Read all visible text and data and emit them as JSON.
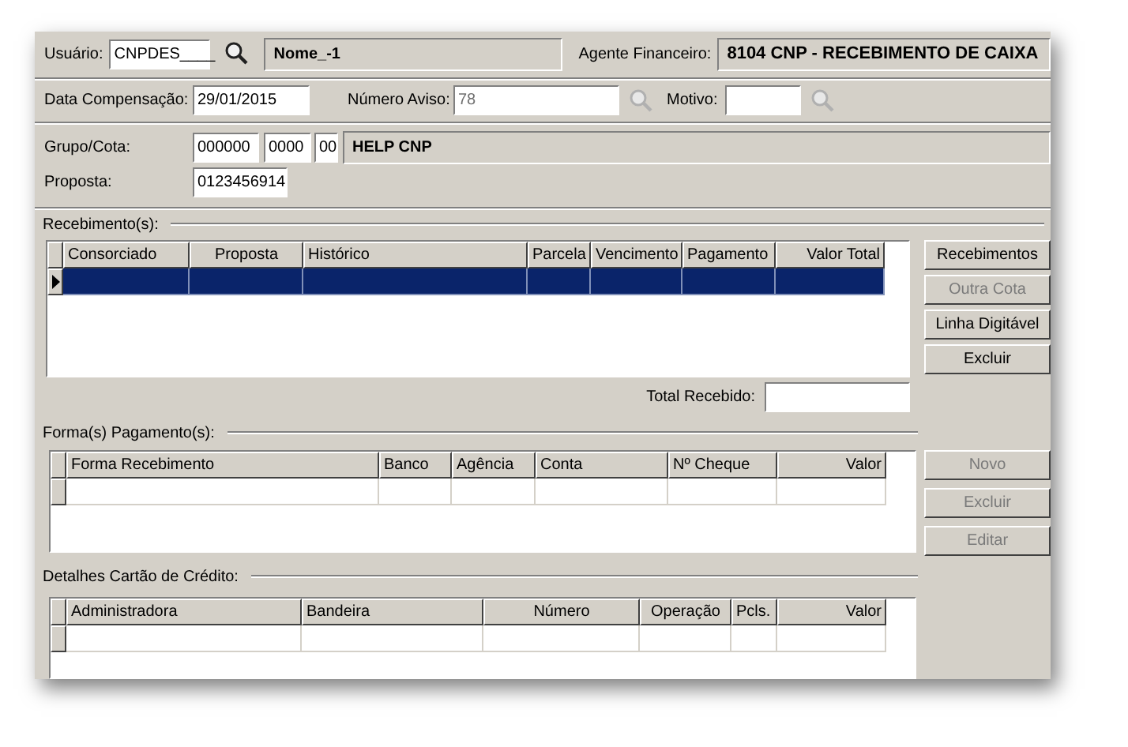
{
  "header": {
    "user": {
      "label": "Usuário:",
      "value": "CNPDES____",
      "lookup_disabled": false
    },
    "name": "Nome_-1",
    "agent": {
      "label": "Agente Financeiro:",
      "value": "8104  CNP - RECEBIMENTO DE CAIXA"
    }
  },
  "filters": {
    "date": {
      "label": "Data Compensação:",
      "value": "29/01/2015"
    },
    "notice": {
      "label": "Número Aviso:",
      "value": "78",
      "disabled": true,
      "lookup_disabled": true
    },
    "reason": {
      "label": "Motivo:",
      "lookup_disabled": true
    }
  },
  "group_quota": {
    "label": "Grupo/Cota:",
    "group": "000000",
    "quota": "0000",
    "digit": "00",
    "description": "HELP CNP"
  },
  "proposal": {
    "label": "Proposta:",
    "value": "0123456914"
  },
  "receipts": {
    "title": "Recebimento(s):",
    "columns": [
      {
        "label": "Consorciado"
      },
      {
        "label": "Proposta"
      },
      {
        "label": "Histórico"
      },
      {
        "label": "Parcela"
      },
      {
        "label": "Vencimento"
      },
      {
        "label": "Pagamento"
      },
      {
        "label": "Valor Total"
      }
    ],
    "rows": [
      {
        "selected": true
      }
    ],
    "buttons": [
      {
        "label": "Recebimentos",
        "disabled": false
      },
      {
        "label": "Outra Cota",
        "disabled": true
      },
      {
        "label": "Linha Digitável",
        "disabled": false
      },
      {
        "label": "Excluir",
        "disabled": false
      }
    ],
    "total": {
      "label": "Total Recebido:"
    }
  },
  "payments": {
    "title": "Forma(s) Pagamento(s):",
    "columns": [
      {
        "label": "Forma Recebimento"
      },
      {
        "label": "Banco"
      },
      {
        "label": "Agência"
      },
      {
        "label": "Conta"
      },
      {
        "label": "Nº Cheque"
      },
      {
        "label": "Valor"
      }
    ],
    "rows": [
      {
        "selected": false
      }
    ],
    "buttons": [
      {
        "label": "Novo",
        "disabled": true
      },
      {
        "label": "Excluir",
        "disabled": true
      },
      {
        "label": "Editar",
        "disabled": true
      }
    ]
  },
  "card_details": {
    "title": "Detalhes Cartão de Crédito:",
    "columns": [
      {
        "label": "Administradora"
      },
      {
        "label": "Bandeira"
      },
      {
        "label": "Número"
      },
      {
        "label": "Operação"
      },
      {
        "label": "Pcls."
      },
      {
        "label": "Valor"
      }
    ],
    "rows": [
      {
        "selected": false
      }
    ]
  }
}
